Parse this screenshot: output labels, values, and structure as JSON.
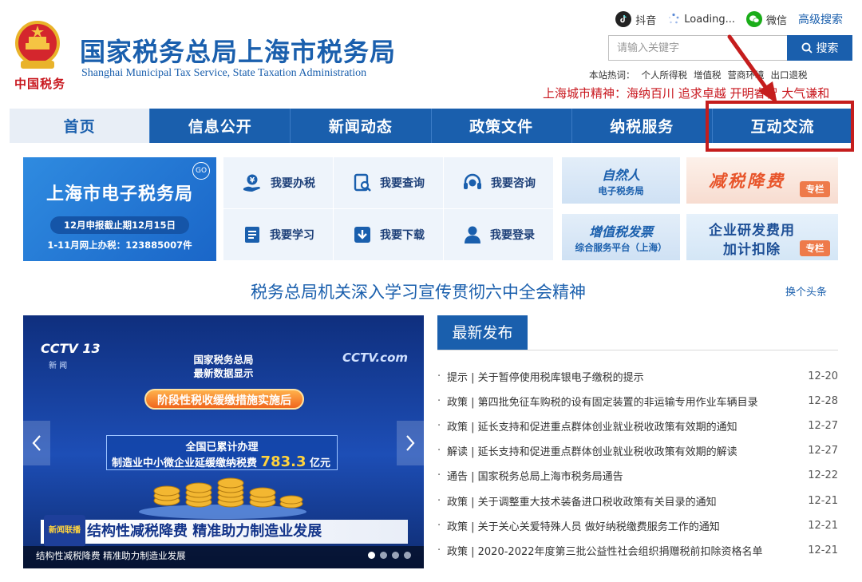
{
  "header": {
    "title": "国家税务总局上海市税务局",
    "subtitle": "Shanghai Municipal Tax Service, State Taxation Administration",
    "emblem_motto": "中国税务",
    "top_links": {
      "douyin": "抖音",
      "loading": "Loading...",
      "wechat": "微信",
      "advanced_search": "高级搜索"
    },
    "search": {
      "placeholder": "请输入关键字",
      "button": "搜索"
    },
    "hot_words_label": "本站热词：",
    "hot_words": [
      "个人所得税",
      "增值税",
      "营商环境",
      "出口退税"
    ],
    "city_spirit": "上海城市精神：海纳百川 追求卓越 开明睿智 大气谦和"
  },
  "nav": {
    "items": [
      "首页",
      "信息公开",
      "新闻动态",
      "政策文件",
      "纳税服务",
      "互动交流"
    ]
  },
  "etax": {
    "title": "上海市电子税务局",
    "badge": "GO",
    "deadline": "12月申报截止期12月15日",
    "count": "1-11月网上办税：123885007件"
  },
  "quick": {
    "items": [
      "我要办税",
      "我要查询",
      "我要咨询",
      "我要学习",
      "我要下载",
      "我要登录"
    ]
  },
  "promos": {
    "natural_person": {
      "line1": "自然人",
      "line2": "电子税务局"
    },
    "tax_cut": {
      "text": "减税降费",
      "tag": "专栏"
    },
    "vat_invoice": {
      "line1": "增值税发票",
      "line2": "综合服务平台（上海）"
    },
    "rnd": {
      "line1": "企业研发费用",
      "line2": "加计扣除",
      "tag": "专栏"
    }
  },
  "headline": {
    "text": "税务总局机关深入学习宣传贯彻六中全会精神",
    "change": "换个头条"
  },
  "carousel": {
    "cctv": "CCTV 13",
    "cctv_sub": "新 闻",
    "cctv_com": "CCTV.com",
    "line1": "国家税务总局",
    "line2": "最新数据显示",
    "orange": "阶段性税收缓缴措施实施后",
    "panel_line1": "全国已累计办理",
    "panel_line2": "制造业中小微企业延缓缴纳税费",
    "panel_number": "783.3",
    "panel_unit": "亿元",
    "logo": "新闻联播",
    "banner": "结构性减税降费 精准助力制造业发展",
    "caption": "结构性减税降费 精准助力制造业发展",
    "slide_count": 4,
    "active_slide": 1
  },
  "news": {
    "tab": "最新发布",
    "items": [
      {
        "title": "提示 | 关于暂停使用税库银电子缴税的提示",
        "date": "12-20"
      },
      {
        "title": "政策 | 第四批免征车购税的设有固定装置的非运输专用作业车辆目录",
        "date": "12-28"
      },
      {
        "title": "政策 | 延长支持和促进重点群体创业就业税收政策有效期的通知",
        "date": "12-27"
      },
      {
        "title": "解读 | 延长支持和促进重点群体创业就业税收政策有效期的解读",
        "date": "12-27"
      },
      {
        "title": "通告 | 国家税务总局上海市税务局通告",
        "date": "12-22"
      },
      {
        "title": "政策 | 关于调整重大技术装备进口税收政策有关目录的通知",
        "date": "12-21"
      },
      {
        "title": "政策 | 关于关心关爱特殊人员 做好纳税缴费服务工作的通知",
        "date": "12-21"
      },
      {
        "title": "政策 | 2020-2022年度第三批公益性社会组织捐赠税前扣除资格名单",
        "date": "12-21"
      }
    ]
  },
  "colors": {
    "brand_blue": "#1a5fad",
    "accent_red": "#c8161d",
    "annotation_red": "#c51d1d"
  }
}
